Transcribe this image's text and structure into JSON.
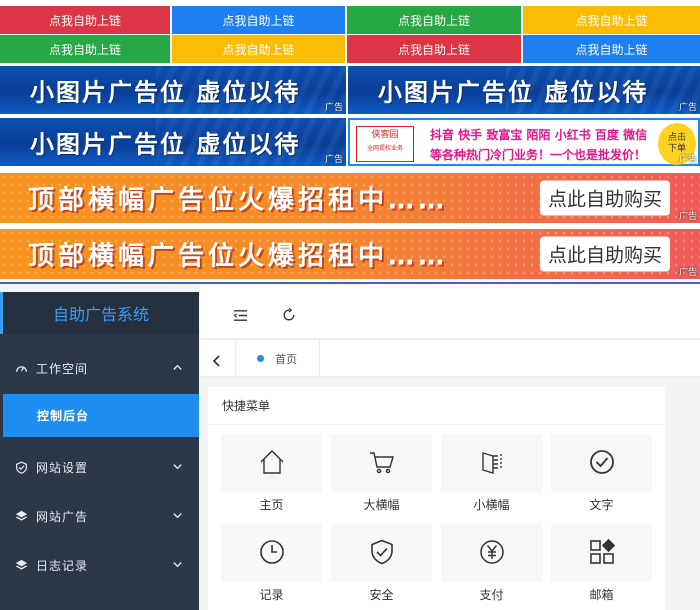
{
  "text_ad_buttons": [
    {
      "label": "点我自助上链",
      "color": "red"
    },
    {
      "label": "点我自助上链",
      "color": "blue"
    },
    {
      "label": "点我自助上链",
      "color": "green"
    },
    {
      "label": "点我自助上链",
      "color": "yellow"
    },
    {
      "label": "点我自助上链",
      "color": "green"
    },
    {
      "label": "点我自助上链",
      "color": "yellow"
    },
    {
      "label": "点我自助上链",
      "color": "red"
    },
    {
      "label": "点我自助上链",
      "color": "blue"
    }
  ],
  "small_banner": {
    "text": "小图片广告位 虚位以待",
    "ad_tag": "广告"
  },
  "promo_banner": {
    "logo_line1": "侠客园",
    "logo_line2": "全网提权业务",
    "line1": "抖音 快手 致富宝 陌陌 小红书 百度 微信",
    "line2": "等各种热门冷门业务！一个也是批发价！",
    "buy_label_1": "点击",
    "buy_label_2": "下单",
    "ad_tag": "广告"
  },
  "top_banner": {
    "text": "顶部横幅广告位火爆招租中……",
    "cta": "点此自助购买",
    "ad_tag": "广告"
  },
  "admin": {
    "brand": "自助广告系统",
    "sidebar": [
      {
        "label": "工作空间",
        "icon": "dashboard-icon",
        "expanded": true
      },
      {
        "label": "控制后台",
        "active": true
      },
      {
        "label": "网站设置",
        "icon": "shield-check-icon"
      },
      {
        "label": "网站广告",
        "icon": "layers-icon"
      },
      {
        "label": "日志记录",
        "icon": "layers-icon"
      }
    ],
    "tab_home": "首页",
    "panel_title": "快捷菜单",
    "shortcuts": [
      {
        "label": "主页",
        "icon": "home-icon"
      },
      {
        "label": "大横幅",
        "icon": "cart-icon"
      },
      {
        "label": "小横幅",
        "icon": "book-icon"
      },
      {
        "label": "文字",
        "icon": "check-circle-icon"
      },
      {
        "label": "记录",
        "icon": "clock-icon"
      },
      {
        "label": "安全",
        "icon": "shield-check-icon"
      },
      {
        "label": "支付",
        "icon": "yen-circle-icon"
      },
      {
        "label": "邮箱",
        "icon": "apps-icon"
      }
    ]
  }
}
